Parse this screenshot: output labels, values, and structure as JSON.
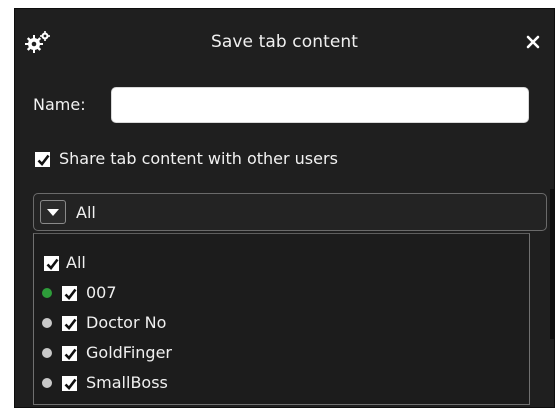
{
  "dialog": {
    "title": "Save tab content",
    "header_icon": "gears-icon",
    "close_icon": "close-icon"
  },
  "name_field": {
    "label": "Name:",
    "value": "",
    "placeholder": ""
  },
  "share": {
    "label": "Share tab content with other users",
    "checked": true
  },
  "filter": {
    "selected": "All",
    "toggle_icon": "chevron-down-icon",
    "items": [
      {
        "label": "All",
        "checked": true,
        "status": null
      },
      {
        "label": "007",
        "checked": true,
        "status": "online"
      },
      {
        "label": "Doctor No",
        "checked": true,
        "status": "offline"
      },
      {
        "label": "GoldFinger",
        "checked": true,
        "status": "offline"
      },
      {
        "label": "SmallBoss",
        "checked": true,
        "status": "offline"
      }
    ]
  },
  "colors": {
    "background": "#1f1f1f",
    "status_online": "#2e9d3a",
    "status_offline": "#c9c9c9",
    "text": "#f0f0f0"
  }
}
